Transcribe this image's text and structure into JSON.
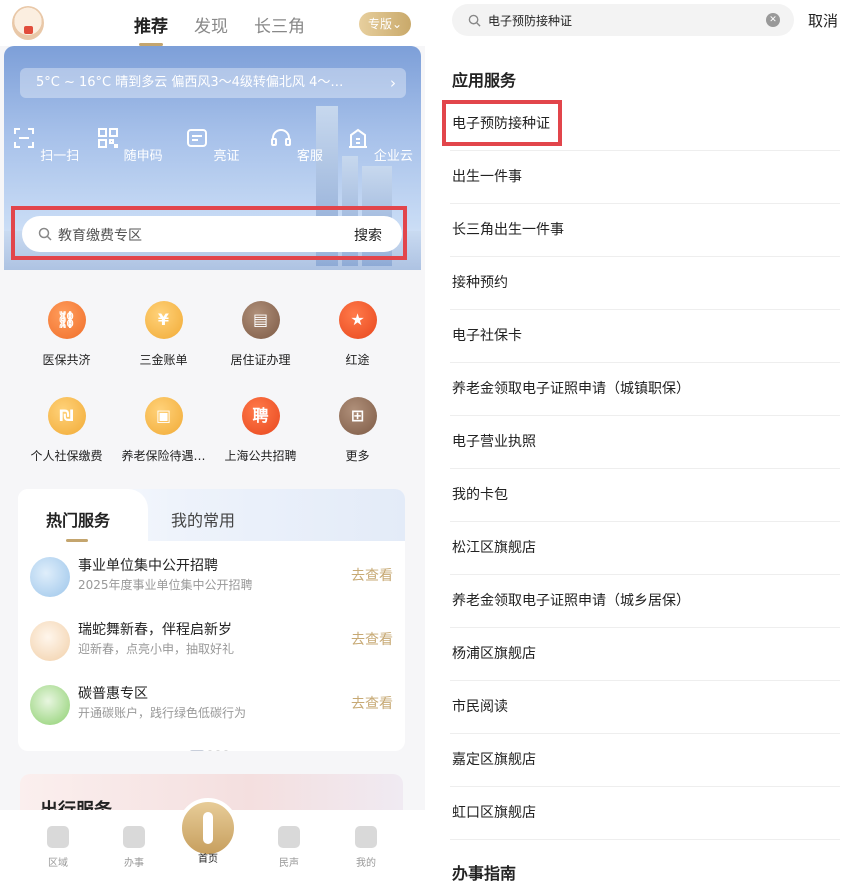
{
  "left": {
    "top_tabs": [
      "推荐",
      "发现",
      "长三角"
    ],
    "version_button": "专版",
    "weather": "5°C ~ 16°C  晴到多云  偏西风3～4级转偏北风  4～…",
    "quick_actions": [
      "扫一扫",
      "随申码",
      "亮证",
      "客服",
      "企业云"
    ],
    "search": {
      "placeholder": "教育缴费专区",
      "button": "搜索"
    },
    "grid": [
      {
        "label": "医保共济",
        "color": "orange",
        "glyph": "⛓"
      },
      {
        "label": "三金账单",
        "color": "gold",
        "glyph": "¥"
      },
      {
        "label": "居住证办理",
        "color": "brown",
        "glyph": "▤"
      },
      {
        "label": "红途",
        "color": "red",
        "glyph": "★"
      },
      {
        "label": "个人社保缴费",
        "color": "gold",
        "glyph": "₪"
      },
      {
        "label": "养老保险待遇…",
        "color": "gold",
        "glyph": "▣"
      },
      {
        "label": "上海公共招聘",
        "color": "red",
        "glyph": "聘"
      },
      {
        "label": "更多",
        "color": "brown",
        "glyph": "⊞"
      }
    ],
    "hot": {
      "tabs": [
        "热门服务",
        "我的常用"
      ],
      "items": [
        {
          "title": "事业单位集中公开招聘",
          "sub": "2025年度事业单位集中公开招聘",
          "action": "去查看"
        },
        {
          "title": "瑞蛇舞新春，伴程启新岁",
          "sub": "迎新春，点亮小申，抽取好礼",
          "action": "去查看"
        },
        {
          "title": "碳普惠专区",
          "sub": "开通碳账户，践行绿色低碳行为",
          "action": "去查看"
        }
      ]
    },
    "travel_title": "出行服务",
    "tabbar": [
      "区域",
      "办事",
      "首页",
      "民声",
      "我的"
    ]
  },
  "right": {
    "search_value": "电子预防接种证",
    "cancel": "取消",
    "section_title": "应用服务",
    "results": [
      "电子预防接种证",
      "出生一件事",
      "长三角出生一件事",
      "接种预约",
      "电子社保卡",
      "养老金领取电子证照申请（城镇职保）",
      "电子营业执照",
      "我的卡包",
      "松江区旗舰店",
      "养老金领取电子证照申请（城乡居保）",
      "杨浦区旗舰店",
      "市民阅读",
      "嘉定区旗舰店",
      "虹口区旗舰店"
    ],
    "section_title_2": "办事指南"
  },
  "colors": {
    "accent_gold": "#c4a56e",
    "highlight_red": "#e2454b"
  }
}
